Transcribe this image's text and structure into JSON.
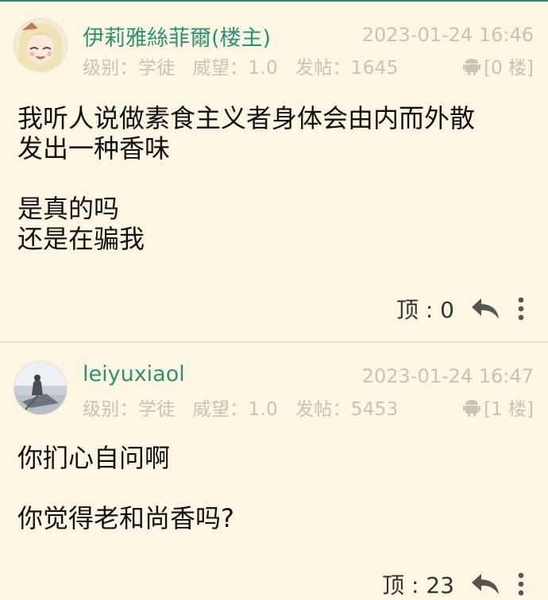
{
  "posts": [
    {
      "author": "伊莉雅絲菲爾(楼主)",
      "time": "2023-01-24 16:46",
      "level": "级别：学徒",
      "prestige": "威望：1.0",
      "post_count": "发帖：1645",
      "floor": "[0 楼]",
      "content": [
        "我听人说做素食主义者身体会由内而外散",
        "发出一种香味",
        "",
        "是真的吗",
        "还是在骗我"
      ],
      "votes": "顶 : 0"
    },
    {
      "author": "leiyuxiaol",
      "time": "2023-01-24 16:47",
      "level": "级别：学徒",
      "prestige": "威望：1.0",
      "post_count": "发帖：5453",
      "floor": "[1 楼]",
      "content": [
        "你扪心自问啊",
        "",
        "你觉得老和尚香吗?"
      ],
      "votes": "顶 : 23"
    }
  ],
  "colors": {
    "accent": "#2e9174",
    "background": "#fdf6e3",
    "muted": "#c9c3b5",
    "text": "#111111"
  },
  "icons": {
    "device": "android-icon",
    "reply": "reply-icon",
    "more": "more-vertical-icon"
  }
}
